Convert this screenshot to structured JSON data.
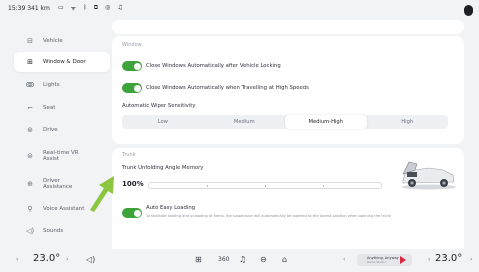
{
  "status": {
    "time_dist": "15:39 341 km",
    "icons": [
      "battery-icon",
      "signal-icon",
      "bluetooth-icon",
      "display-icon",
      "location-icon",
      "bell-icon"
    ]
  },
  "sidebar": {
    "items": [
      {
        "label": "Vehicle",
        "icon": "car-icon"
      },
      {
        "label": "Window & Door",
        "icon": "door-icon"
      },
      {
        "label": "Lights",
        "icon": "light-icon"
      },
      {
        "label": "Seat",
        "icon": "seat-icon"
      },
      {
        "label": "Drive",
        "icon": "steering-icon"
      },
      {
        "label": "Real-time VR Assist",
        "icon": "vr-icon"
      },
      {
        "label": "Driver Assistance",
        "icon": "assist-icon"
      },
      {
        "label": "Voice Assistant",
        "icon": "voice-icon"
      },
      {
        "label": "Sounds",
        "icon": "speaker-icon"
      }
    ],
    "active_index": 1
  },
  "window": {
    "section": "Window",
    "opt1": "Close Windows Automatically after Vehicle Locking",
    "opt2": "Close Windows Automatically when Travelling at High Speeds",
    "wiper_label": "Automatic Wiper Sensitivity",
    "wiper_options": [
      "Low",
      "Medium",
      "Medium-High",
      "High"
    ],
    "wiper_selected": "Medium-High"
  },
  "trunk": {
    "section": "Trunk",
    "angle_label": "Trunk Unfolding Angle Memory",
    "angle_value": "100%",
    "angle_fraction": 1.0,
    "easy_label": "Auto Easy Loading",
    "easy_desc": "To facilitate loading and unloading of items, the suspension will automatically be lowered to the lowest position when opening the trunk"
  },
  "bottom": {
    "temp_left": "23.0°",
    "temp_right": "23.0°",
    "media_title": "Anything, Anyway",
    "media_sub": "Radio Studio"
  },
  "colors": {
    "toggle_on": "#3fa33c",
    "arrow": "#8cc63f"
  }
}
